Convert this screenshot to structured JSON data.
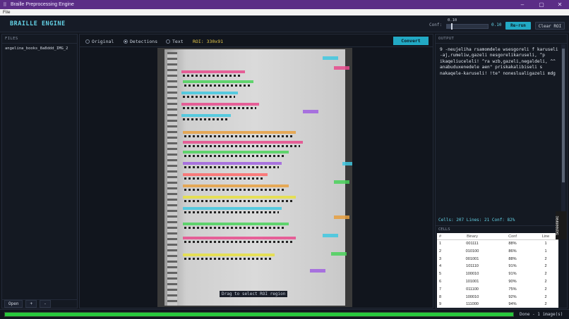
{
  "window": {
    "app_icon": "braille-icon",
    "title": "Braille Preprocessing Engine",
    "minimize": "–",
    "maximize": "▢",
    "close": "✕"
  },
  "menu": {
    "file": "File"
  },
  "header": {
    "brand": "BRAILLE ENGINE",
    "conf_label": "Conf:",
    "conf_tick": "0.10",
    "conf_value": "0.10",
    "rerun": "Re-run",
    "clear_roi": "Clear ROI"
  },
  "files": {
    "title": "FILES",
    "items": [
      "angelina_books_8a8ddd_IMG_2"
    ],
    "open": "Open",
    "add": "+",
    "remove": "-"
  },
  "view": {
    "modes": [
      {
        "label": "Original",
        "selected": false
      },
      {
        "label": "Detections",
        "selected": true
      },
      {
        "label": "Text",
        "selected": false
      }
    ],
    "roi": "ROI: 330x91",
    "convert": "Convert",
    "hint": "Drag to select ROI region"
  },
  "output": {
    "title": "OUTPUT",
    "text": "9 -neujeliha rsamomdele wsesgoreli f karuseli -aj,rumeliw,gazeli nesgorelikaruseli, ^p ikaqeliuceleli! ^ra wzb,gazeli,negaldeli, ^^ anabuduxenedele aen\" priskakalibiseli s nakaqele-karuseli! !te\" noneslualigazeli mdg",
    "stats": "Cells: 207  Lines: 21  Conf: 82%"
  },
  "cells": {
    "title": "CELLS",
    "columns": [
      "#",
      "Binary",
      "Conf",
      "Line"
    ],
    "rows": [
      [
        "1",
        "001111",
        "88%",
        "1"
      ],
      [
        "2",
        "010100",
        "86%",
        "1"
      ],
      [
        "3",
        "001001",
        "88%",
        "2"
      ],
      [
        "4",
        "101110",
        "91%",
        "2"
      ],
      [
        "5",
        "100010",
        "91%",
        "2"
      ],
      [
        "6",
        "101001",
        "90%",
        "2"
      ],
      [
        "7",
        "011100",
        "75%",
        "2"
      ],
      [
        "8",
        "100010",
        "92%",
        "2"
      ],
      [
        "9",
        "111000",
        "94%",
        "2"
      ]
    ]
  },
  "status": {
    "progress": 1.0,
    "text": "Done - 1 image(s)"
  },
  "watermark": "Screenrec",
  "colors": {
    "accent": "#22a9c4",
    "brand": "#64d2e6",
    "titlebar": "#5b2d86",
    "progress": "#28c83c"
  }
}
